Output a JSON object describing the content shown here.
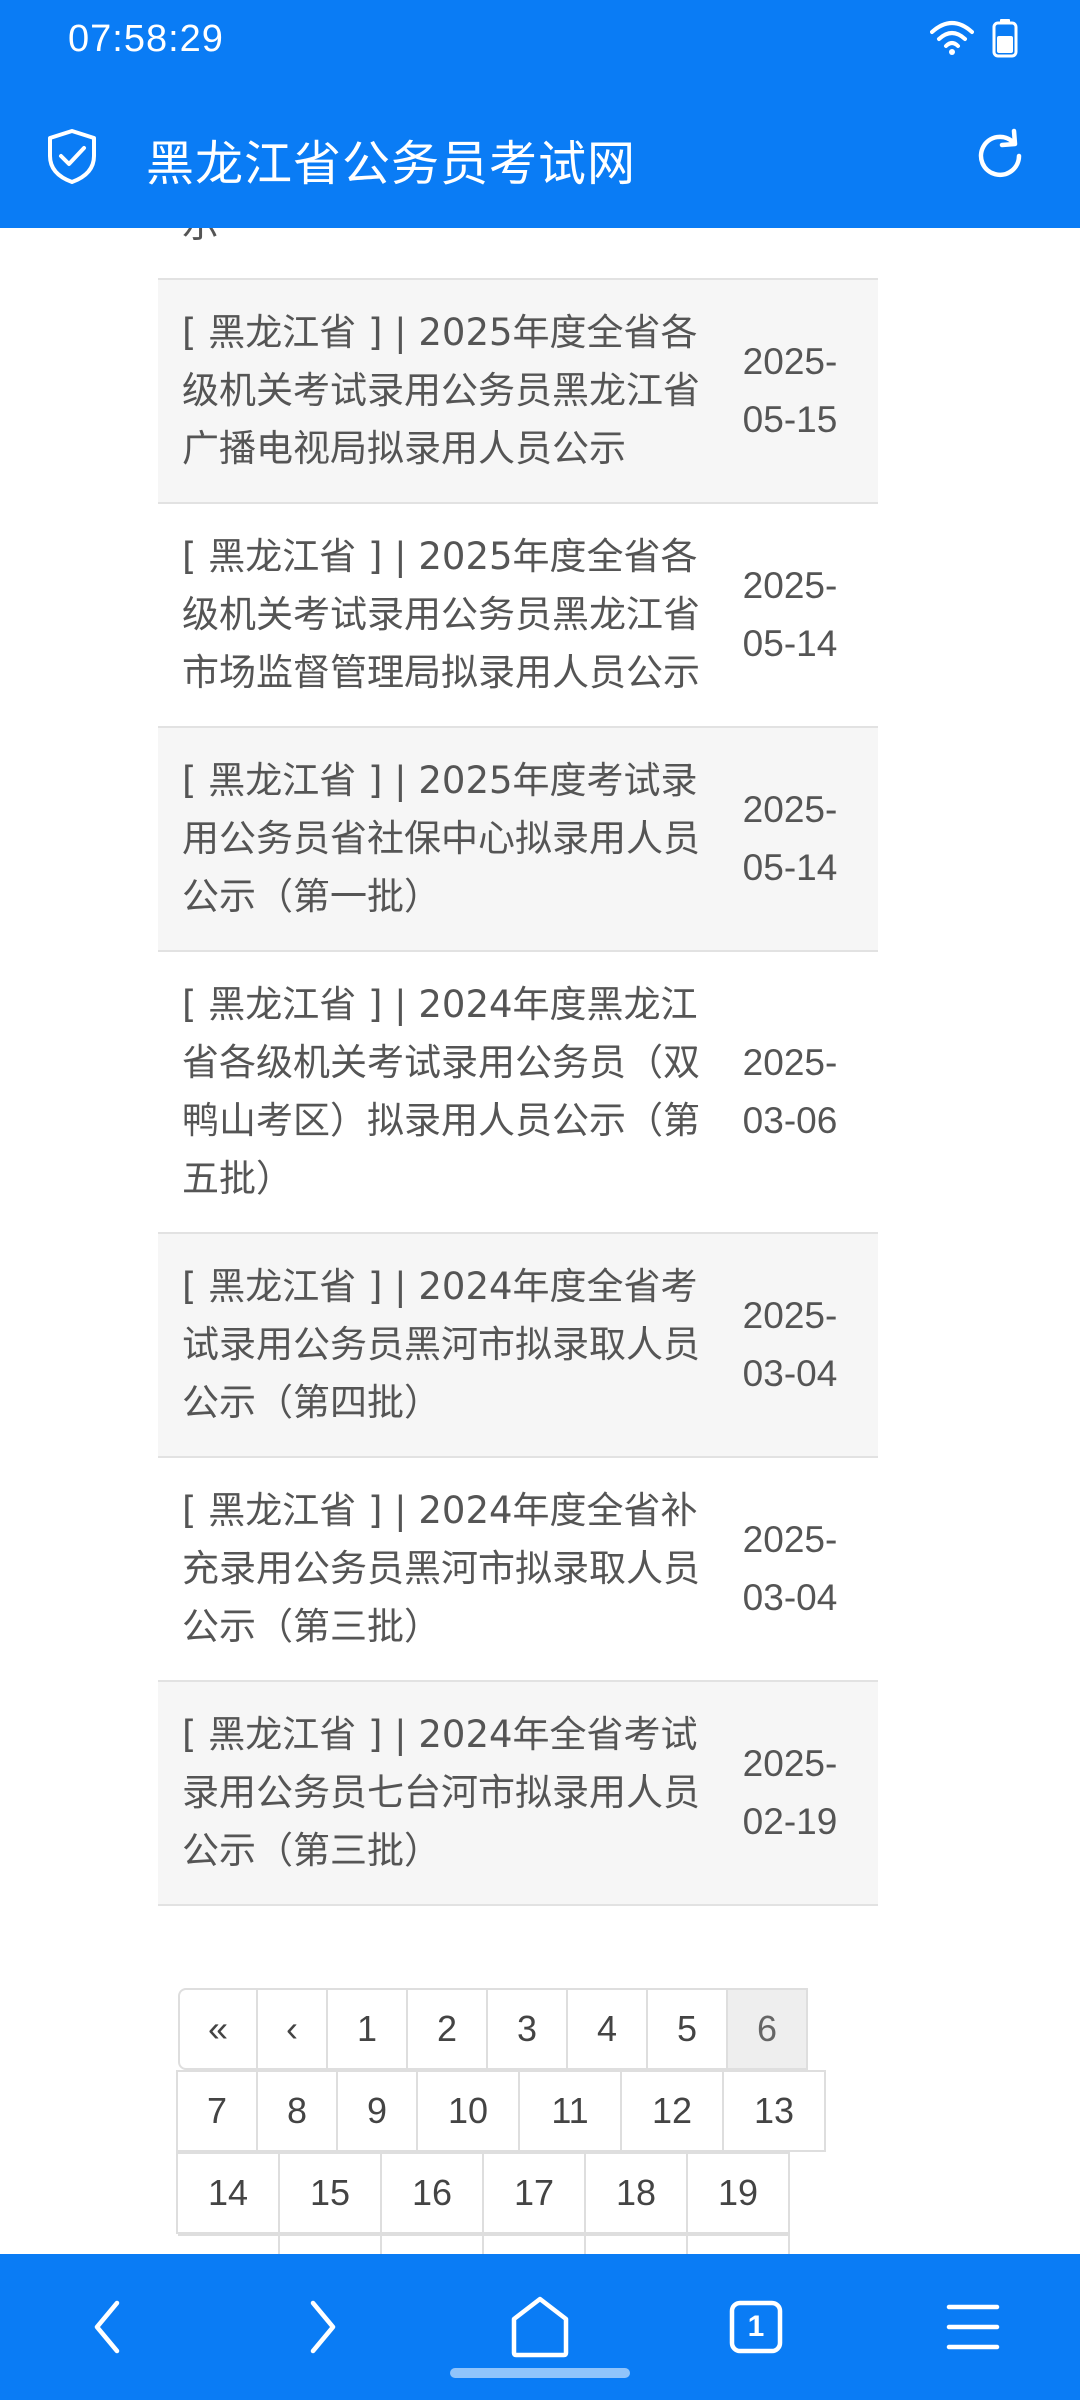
{
  "status": {
    "time": "07:58:29"
  },
  "appbar": {
    "title": "黑龙江省公务员考试网"
  },
  "list": {
    "top_fragment": "示",
    "rows": [
      {
        "title": "[ 黑龙江省 ] | 2025年度全省各级机关考试录用公务员黑龙江省广播电视局拟录用人员公示",
        "date": "2025-05-15"
      },
      {
        "title": "[ 黑龙江省 ] | 2025年度全省各级机关考试录用公务员黑龙江省市场监督管理局拟录用人员公示",
        "date": "2025-05-14"
      },
      {
        "title": "[ 黑龙江省 ] | 2025年度考试录用公务员省社保中心拟录用人员公示（第一批）",
        "date": "2025-05-14"
      },
      {
        "title": "[ 黑龙江省 ] | 2024年度黑龙江省各级机关考试录用公务员（双鸭山考区）拟录用人员公示（第五批）",
        "date": "2025-03-06"
      },
      {
        "title": "[ 黑龙江省 ] | 2024年度全省考试录用公务员黑河市拟录取人员公示（第四批）",
        "date": "2025-03-04"
      },
      {
        "title": "[ 黑龙江省 ] | 2024年度全省补充录用公务员黑河市拟录取人员公示（第三批）",
        "date": "2025-03-04"
      },
      {
        "title": "[ 黑龙江省 ] | 2024年全省考试录用公务员七台河市拟录用人员公示（第三批）",
        "date": "2025-02-19"
      }
    ]
  },
  "pager": {
    "first": "«",
    "prev": "‹",
    "row1": [
      "1",
      "2",
      "3",
      "4",
      "5",
      "6"
    ],
    "row2": [
      "7",
      "8",
      "9",
      "10",
      "11",
      "12",
      "13"
    ],
    "row3": [
      "14",
      "15",
      "16",
      "17",
      "18",
      "19"
    ],
    "active": "6"
  },
  "bottomnav": {
    "tab_count": "1"
  },
  "colors": {
    "brand": "#0a7cf5",
    "row_alt": "#f6f6f6",
    "text": "#555555"
  }
}
